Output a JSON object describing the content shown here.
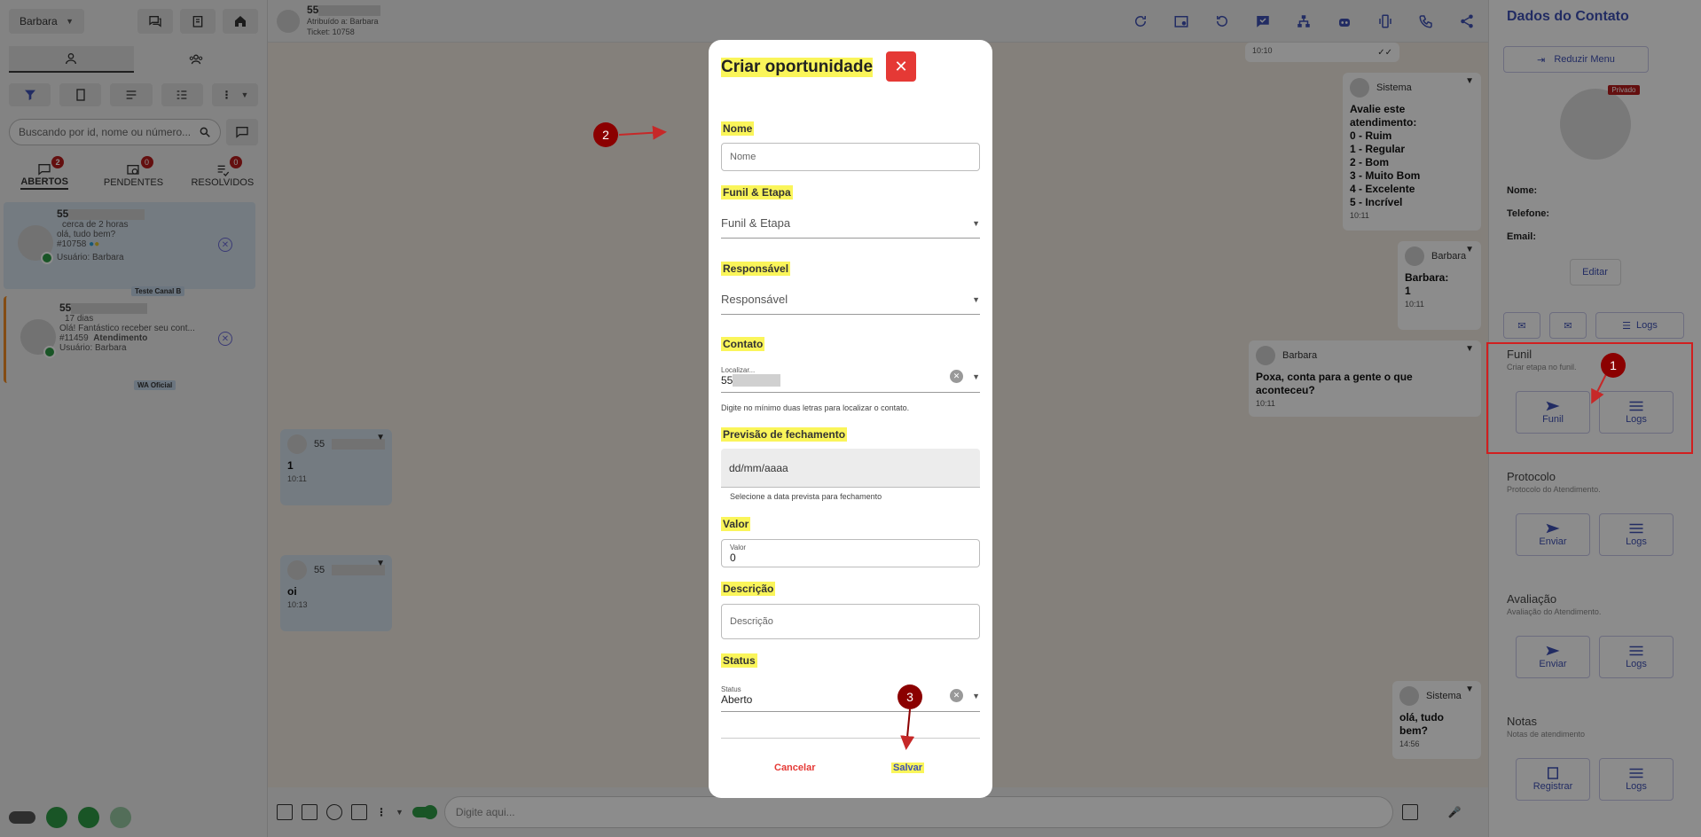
{
  "left": {
    "user": "Barbara",
    "search_placeholder": "Buscando por id, nome ou número...",
    "tabs": [
      {
        "label": "ABERTOS",
        "badge": "2"
      },
      {
        "label": "PENDENTES",
        "badge": "0"
      },
      {
        "label": "RESOLVIDOS",
        "badge": "0"
      }
    ],
    "tickets": [
      {
        "num": "55",
        "time": "cerca de 2 horas",
        "preview": "olá, tudo bem?",
        "id": "#10758",
        "user": "Usuário: Barbara",
        "channel": "Teste Canal B"
      },
      {
        "num": "55",
        "time": "17 dias",
        "preview": "Olá! Fantástico receber seu cont...",
        "id": "#11459",
        "tag": "Atendimento",
        "user": "Usuário: Barbara",
        "channel": "WA Oficial"
      }
    ]
  },
  "chat": {
    "number": "55",
    "assigned": "Atribuído a: Barbara",
    "ticket": "Ticket: 10758",
    "composer_placeholder": "Digite aqui...",
    "messages": [
      {
        "time": "10:10"
      },
      {
        "sender": "Sistema",
        "lines": [
          "Avalie este atendimento:",
          "0 - Ruim",
          "1 - Regular",
          "2 - Bom",
          "3 - Muito Bom",
          "4 - Excelente",
          "5 - Incrível"
        ],
        "time": "10:11"
      },
      {
        "sender": "Barbara",
        "lines": [
          "Barbara:",
          "1"
        ],
        "time": "10:11"
      },
      {
        "sender": "Barbara",
        "lines": [
          "Poxa, conta para a gente o que aconteceu?"
        ],
        "time": "10:11"
      },
      {
        "sender": "55",
        "lines": [
          "1"
        ],
        "time": "10:11"
      },
      {
        "sender": "55",
        "lines": [
          "oi"
        ],
        "time": "10:13"
      },
      {
        "sender": "Sistema",
        "lines": [
          "olá, tudo bem?"
        ],
        "time": "14:56"
      }
    ]
  },
  "right": {
    "title": "Dados do Contato",
    "reduzir": "Reduzir Menu",
    "private_badge": "Privado",
    "fields": {
      "name": "Nome:",
      "phone": "Telefone:",
      "email": "Email:"
    },
    "editar": "Editar",
    "logs": "Logs",
    "sections": [
      {
        "title": "Funil",
        "desc": "Criar etapa no funil.",
        "btn1": "Funil",
        "btn2": "Logs"
      },
      {
        "title": "Protocolo",
        "desc": "Protocolo do Atendimento.",
        "btn1": "Enviar",
        "btn2": "Logs"
      },
      {
        "title": "Avaliação",
        "desc": "Avaliação do Atendimento.",
        "btn1": "Enviar",
        "btn2": "Logs"
      },
      {
        "title": "Notas",
        "desc": "Notas de atendimento",
        "btn1": "Registrar",
        "btn2": "Logs"
      }
    ]
  },
  "modal": {
    "title": "Criar oportunidade",
    "close": "✕",
    "nome_label": "Nome",
    "nome_placeholder": "Nome",
    "funil_label": "Funil & Etapa",
    "funil_value": "Funil & Etapa",
    "resp_label": "Responsável",
    "resp_value": "Responsável",
    "contato_label": "Contato",
    "contato_small": "Localizar...",
    "contato_value": "55",
    "contato_helper": "Digite no mínimo duas letras para localizar o contato.",
    "prev_label": "Previsão de fechamento",
    "prev_value": "dd/mm/aaaa",
    "prev_helper": "Selecione a data prevista para fechamento",
    "valor_label": "Valor",
    "valor_small": "Valor",
    "valor_value": "0",
    "desc_label": "Descrição",
    "desc_placeholder": "Descrição",
    "status_label": "Status",
    "status_small": "Status",
    "status_value": "Aberto",
    "cancel": "Cancelar",
    "save": "Salvar"
  },
  "steps": [
    "1",
    "2",
    "3"
  ],
  "colors": {
    "accent": "#3f51b5",
    "danger": "#e53935",
    "highlight": "#faf55a",
    "step": "#8b0000",
    "annotation_box": "#d11f1f"
  }
}
